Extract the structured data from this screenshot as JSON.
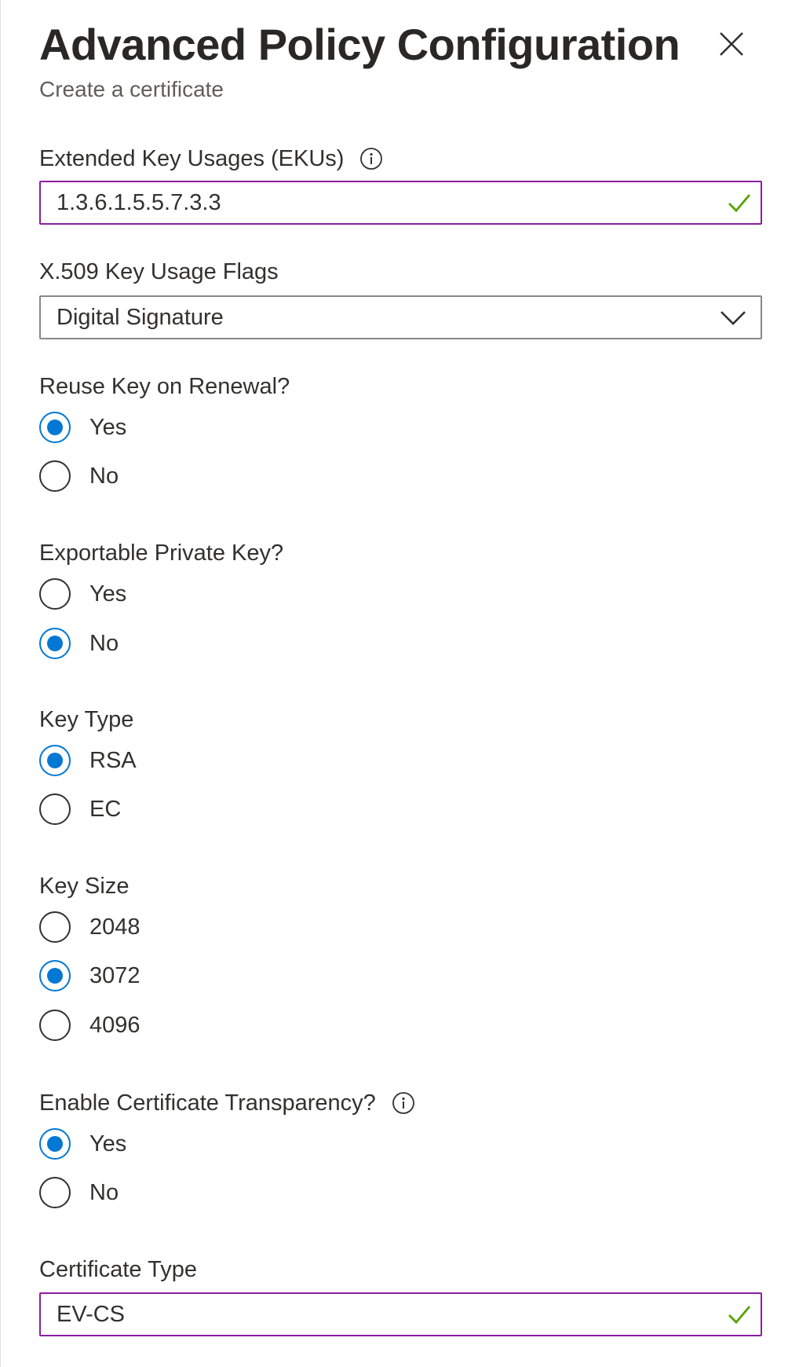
{
  "header": {
    "title": "Advanced Policy Configuration",
    "subtitle": "Create a certificate",
    "close_icon": "close-icon"
  },
  "ekus": {
    "label": "Extended Key Usages (EKUs)",
    "value": "1.3.6.1.5.5.7.3.3",
    "status": "valid"
  },
  "key_usage": {
    "label": "X.509 Key Usage Flags",
    "selected": "Digital Signature"
  },
  "reuse_key": {
    "label": "Reuse Key on Renewal?",
    "options": [
      {
        "label": "Yes",
        "checked": true
      },
      {
        "label": "No",
        "checked": false
      }
    ]
  },
  "exportable": {
    "label": "Exportable Private Key?",
    "options": [
      {
        "label": "Yes",
        "checked": false
      },
      {
        "label": "No",
        "checked": true
      }
    ]
  },
  "key_type": {
    "label": "Key Type",
    "options": [
      {
        "label": "RSA",
        "checked": true
      },
      {
        "label": "EC",
        "checked": false
      }
    ]
  },
  "key_size": {
    "label": "Key Size",
    "options": [
      {
        "label": "2048",
        "checked": false
      },
      {
        "label": "3072",
        "checked": true
      },
      {
        "label": "4096",
        "checked": false
      }
    ]
  },
  "transparency": {
    "label": "Enable Certificate Transparency?",
    "options": [
      {
        "label": "Yes",
        "checked": true
      },
      {
        "label": "No",
        "checked": false
      }
    ]
  },
  "cert_type": {
    "label": "Certificate Type",
    "value": "EV-CS",
    "status": "valid"
  },
  "colors": {
    "accent": "#0078d4",
    "focus_border": "#8a1f9e",
    "valid_check": "#57a300"
  }
}
